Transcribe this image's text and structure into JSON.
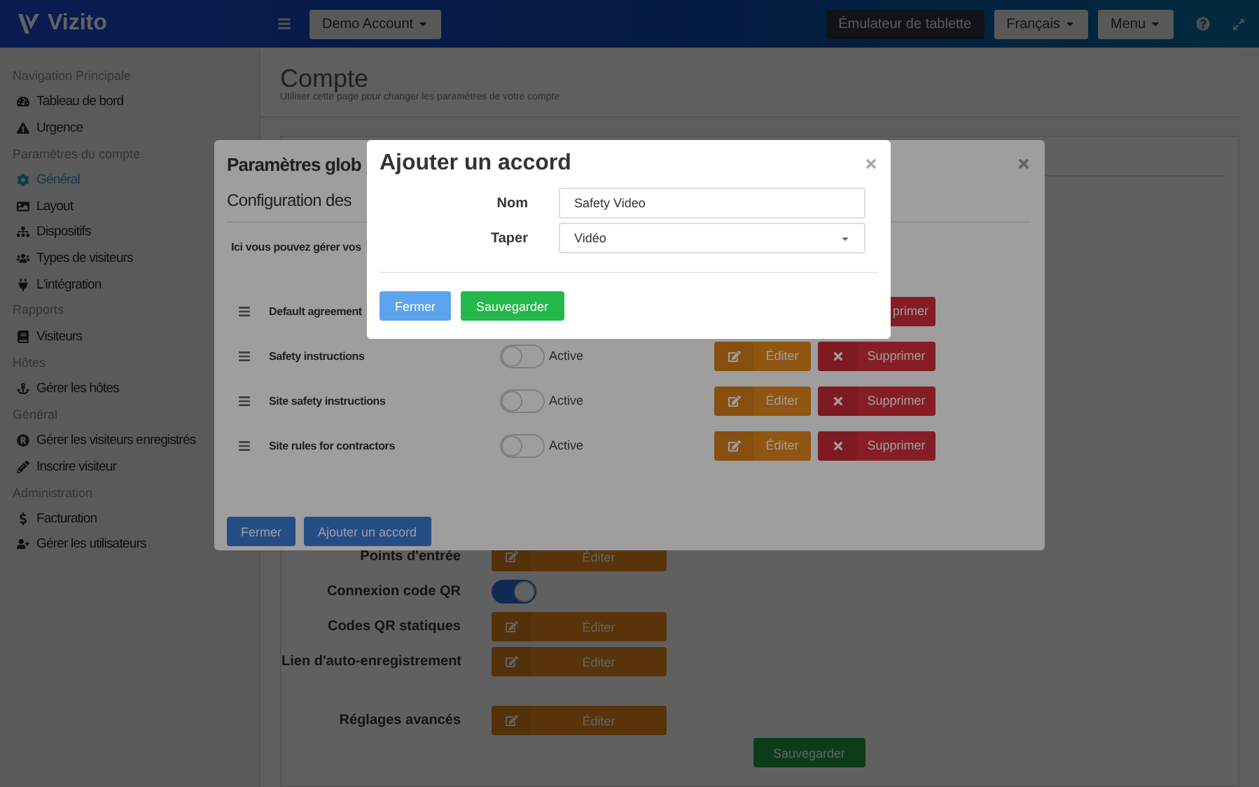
{
  "topbar": {
    "brand": "Vizito",
    "account_button": "Demo Account",
    "tablet_button": "Émulateur de tablette",
    "language_button": "Français",
    "menu_button": "Menu"
  },
  "sidebar": {
    "sections": [
      {
        "heading": "Navigation Principale",
        "items": [
          {
            "label": "Tableau de bord",
            "selected": false
          },
          {
            "label": "Urgence",
            "selected": false
          }
        ]
      },
      {
        "heading": "Paramètres du compte",
        "items": [
          {
            "label": "Général",
            "selected": true
          },
          {
            "label": "Layout",
            "selected": false
          },
          {
            "label": "Dispositifs",
            "selected": false
          },
          {
            "label": "Types de visiteurs",
            "selected": false
          },
          {
            "label": "L'intégration",
            "selected": false
          }
        ]
      },
      {
        "heading": "Rapports",
        "items": [
          {
            "label": "Visiteurs",
            "selected": false
          }
        ]
      },
      {
        "heading": "Hôtes",
        "items": [
          {
            "label": "Gérer les hôtes",
            "selected": false
          }
        ]
      },
      {
        "heading": "Général",
        "items": [
          {
            "label": "Gérer les visiteurs enregistrés",
            "selected": false
          },
          {
            "label": "Inscrire visiteur",
            "selected": false
          }
        ]
      },
      {
        "heading": "Administration",
        "items": [
          {
            "label": "Facturation",
            "selected": false
          },
          {
            "label": "Gérer les utilisateurs",
            "selected": false
          }
        ]
      }
    ]
  },
  "page": {
    "title": "Compte",
    "subtitle": "Utiliser cette page pour changer les paramètres de votre compte",
    "setting_groups": [
      [
        {
          "label": "Points d'entrée",
          "kind": "edit",
          "button": "Éditer"
        },
        {
          "label": "Connexion code QR",
          "kind": "toggle",
          "on": true
        },
        {
          "label": "Codes QR statiques",
          "kind": "edit",
          "button": "Éditer"
        },
        {
          "label": "Lien d'auto-enregistrement",
          "kind": "edit",
          "button": "Éditer"
        }
      ],
      [
        {
          "label": "Réglages avancés",
          "kind": "edit",
          "button": "Éditer"
        }
      ]
    ],
    "save_button": "Sauvegarder"
  },
  "settings_dialog": {
    "title": "Paramètres glob",
    "subtitle": "Configuration des",
    "intro": "Ici vous pouvez gérer vos",
    "agreements": [
      {
        "name": "Default agreement",
        "delete_label": "primer"
      },
      {
        "name": "Safety instructions",
        "on": false,
        "status": "Active",
        "edit_label": "Éditer",
        "delete_label": "Supprimer"
      },
      {
        "name": "Site safety instructions",
        "on": false,
        "status": "Active",
        "edit_label": "Éditer",
        "delete_label": "Supprimer"
      },
      {
        "name": "Site rules for contractors",
        "on": false,
        "status": "Active",
        "edit_label": "Éditer",
        "delete_label": "Supprimer"
      }
    ],
    "buttons": [
      "Fermer",
      "Ajouter un accord"
    ]
  },
  "agreement_dialog": {
    "title": "Ajouter un accord",
    "fields": [
      {
        "label": "Nom",
        "kind": "text",
        "value": "Safety Video"
      },
      {
        "label": "Taper",
        "kind": "select",
        "value": "Vidéo"
      }
    ],
    "buttons": [
      {
        "label": "Fermer",
        "kind": "secondary"
      },
      {
        "label": "Sauvegarder",
        "kind": "primary"
      }
    ]
  }
}
